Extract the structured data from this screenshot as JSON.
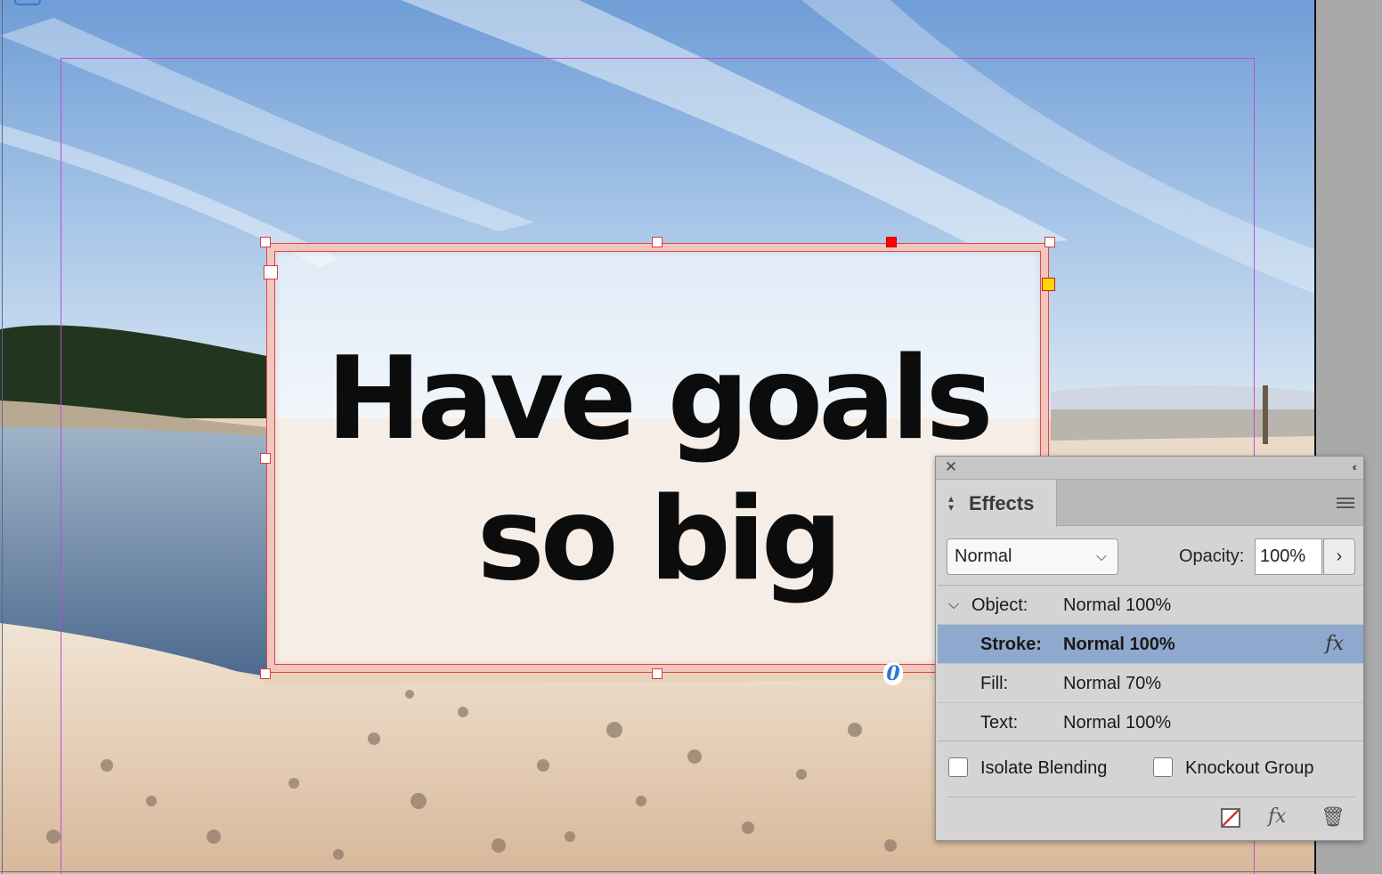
{
  "canvas": {
    "headline_line1": "Have goals",
    "headline_line2": "so big",
    "overset_marker": "0"
  },
  "effects_panel": {
    "close_glyph": "✕",
    "collapse_glyph": "‹‹",
    "tab_label": "Effects",
    "blend_mode": "Normal",
    "opacity_label": "Opacity:",
    "opacity_value": "100%",
    "levels": [
      {
        "label": "Object:",
        "value": "Normal 100%",
        "selected": false
      },
      {
        "label": "Stroke:",
        "value": "Normal 100%",
        "selected": true
      },
      {
        "label": "Fill:",
        "value": "Normal 70%",
        "selected": false
      },
      {
        "label": "Text:",
        "value": "Normal 100%",
        "selected": false
      }
    ],
    "isolate_blending_label": "Isolate Blending",
    "knockout_group_label": "Knockout Group",
    "fx_glyph": "fx"
  },
  "colors": {
    "selection_highlight": "#8fa8cd",
    "frame_stroke": "#dd4a40",
    "margin_guide": "#c04ad8"
  }
}
